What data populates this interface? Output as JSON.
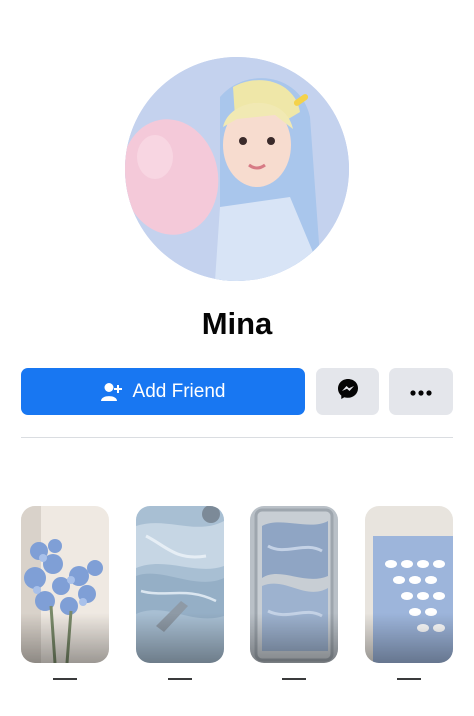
{
  "profile": {
    "name": "Mina"
  },
  "actions": {
    "add_friend_label": "Add Friend",
    "add_friend_icon": "user-plus-icon",
    "messenger_icon": "messenger-icon",
    "more_icon": "more-dots-icon"
  },
  "colors": {
    "primary": "#1877f2",
    "secondary_button": "#e4e6eb",
    "divider": "#dadde1",
    "text": "#050505"
  },
  "stories": [
    {
      "image": "blue-flowers-photo"
    },
    {
      "image": "blue-paint-strokes-photo"
    },
    {
      "image": "blue-cream-tray-photo"
    },
    {
      "image": "cloud-pattern-card-photo"
    }
  ]
}
